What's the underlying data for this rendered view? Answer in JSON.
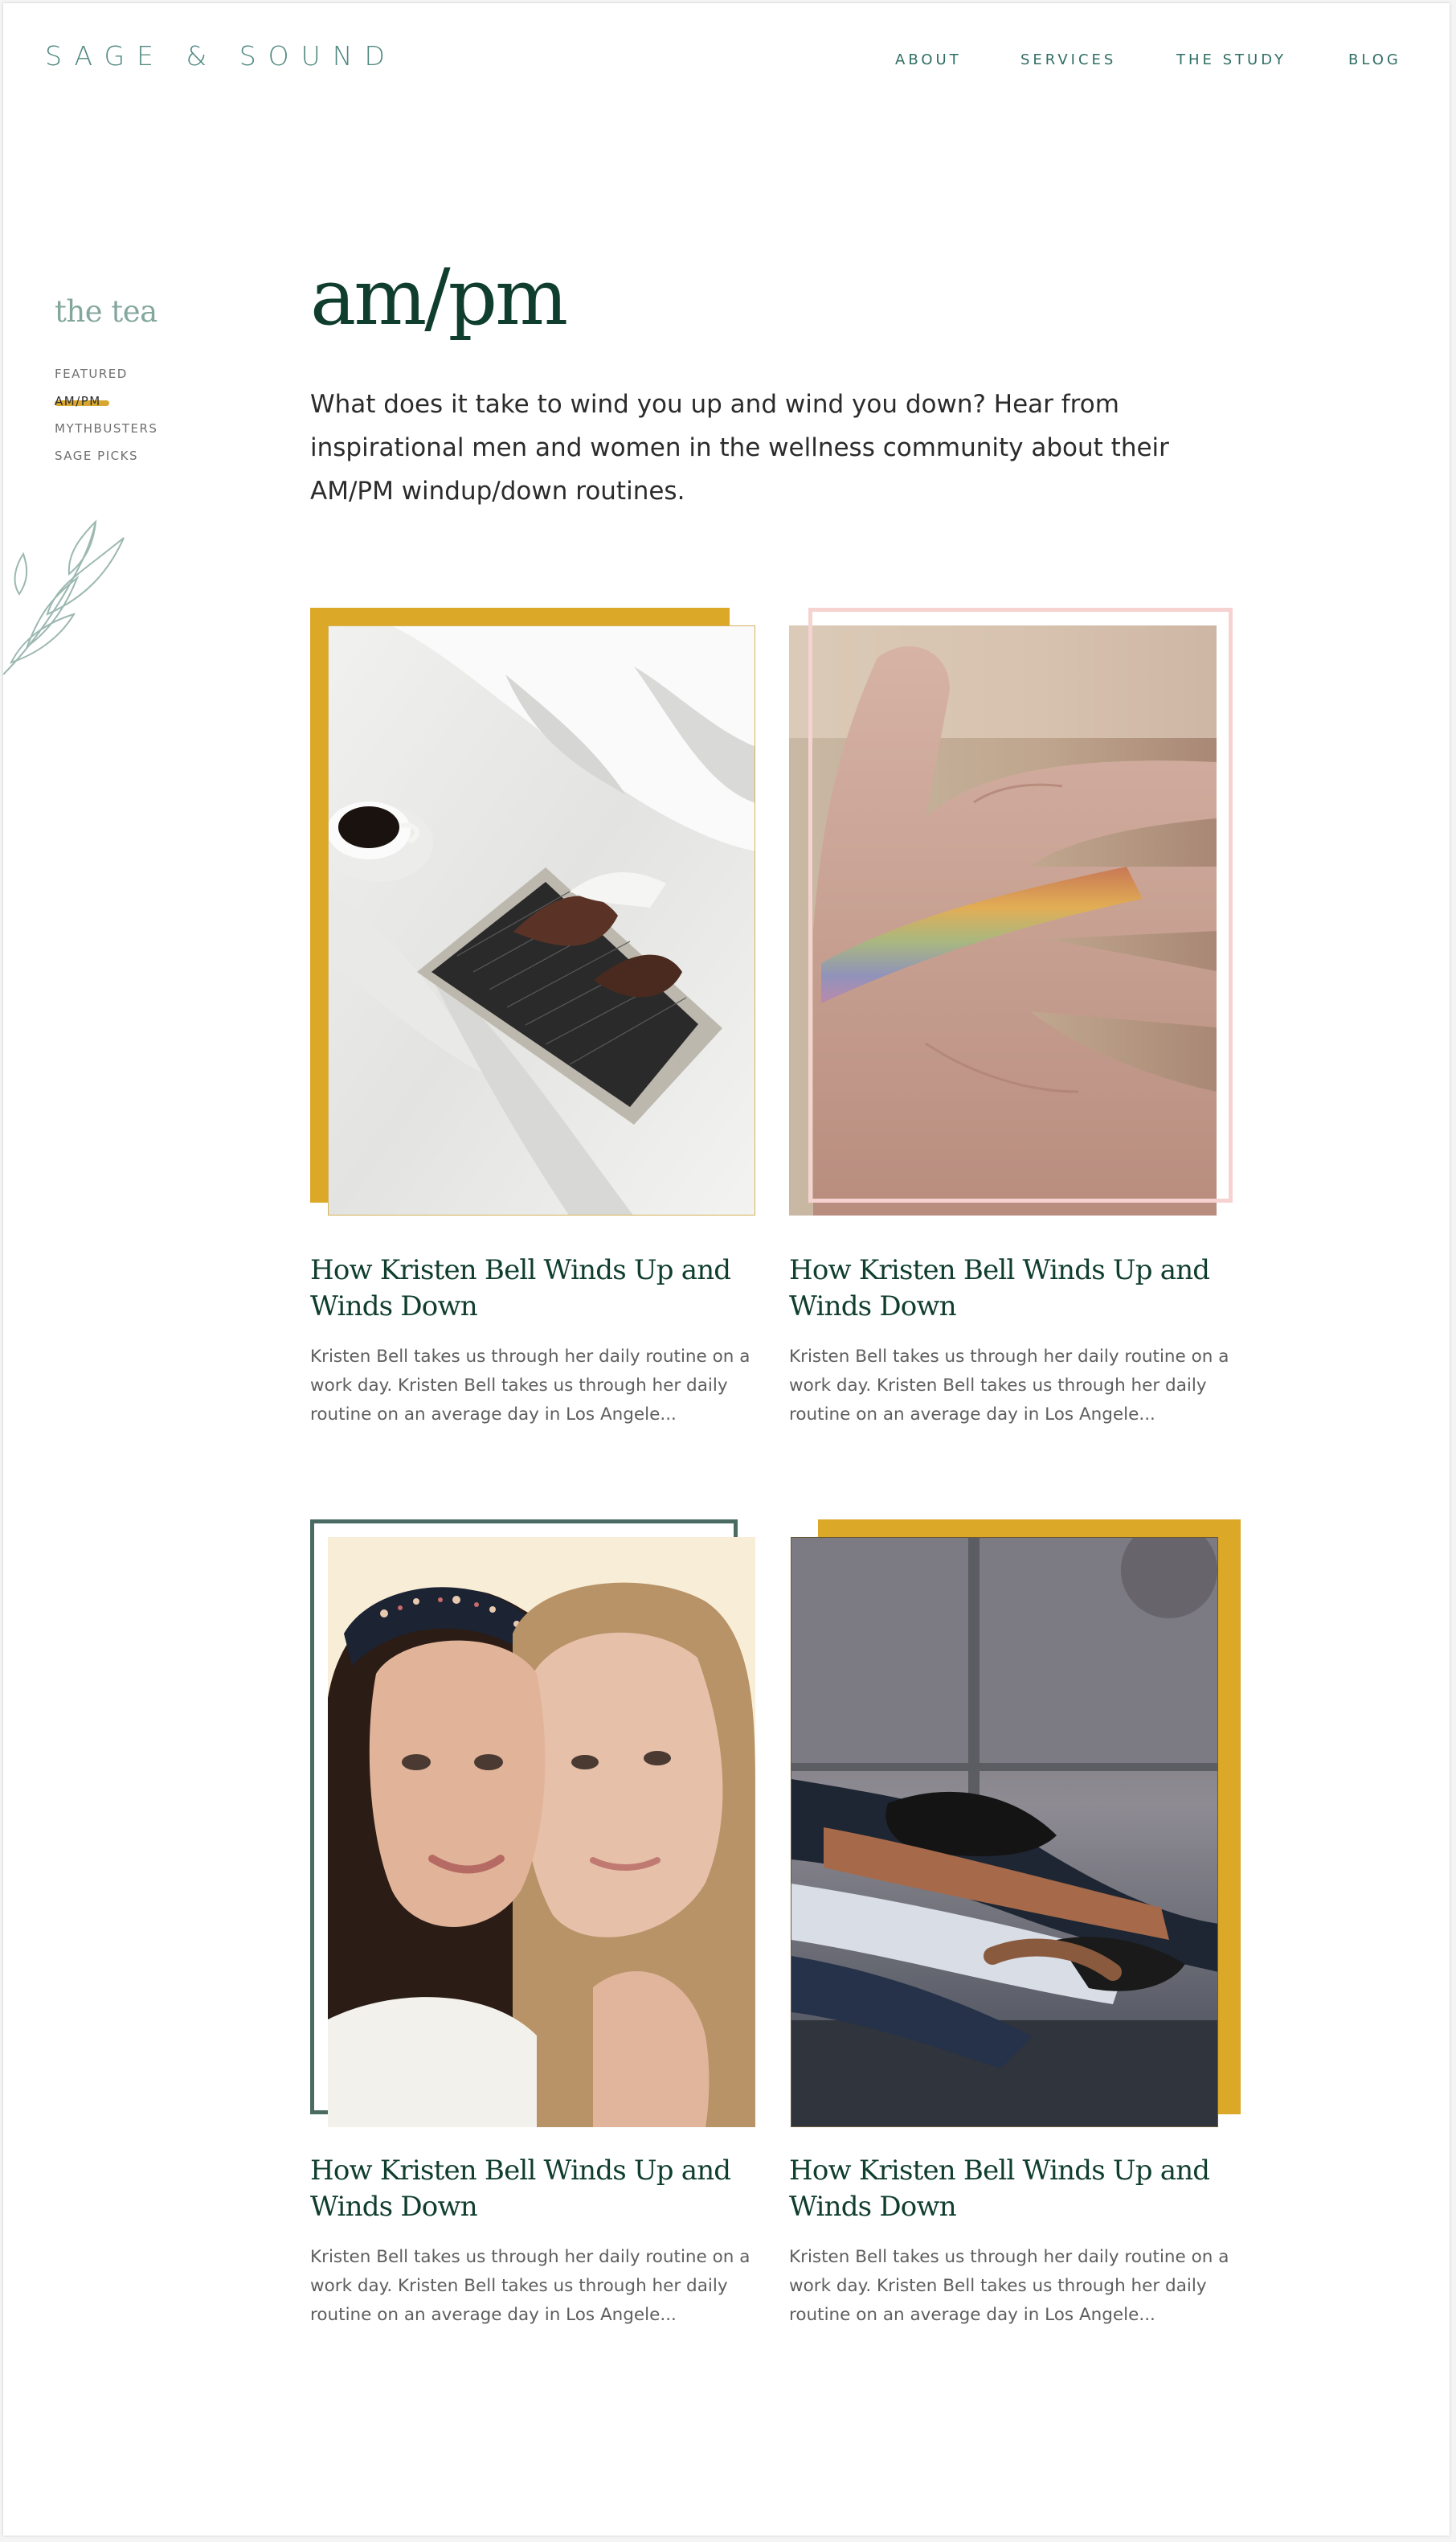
{
  "brand": {
    "name": "SAGE & SOUND"
  },
  "nav": {
    "about": "ABOUT",
    "services": "SERVICES",
    "the_study": "THE STUDY",
    "blog": "BLOG"
  },
  "sidebar": {
    "title": "the tea",
    "items": [
      "FEATURED",
      "AM/PM",
      "MYTHBUSTERS",
      "SAGE PICKS"
    ],
    "active": "AM/PM"
  },
  "page": {
    "title": "am/pm",
    "intro": "What does it take to wind you up and wind you down? Hear from inspirational men and women in the wellness  community about their AM/PM windup/down routines."
  },
  "posts": [
    {
      "title": "How Kristen Bell Winds Up and Winds Down",
      "excerpt": "Kristen Bell takes us through her daily routine on a work day. Kristen Bell takes us through her daily routine on an average day in Los Angele...",
      "image": "laptop-in-bed-photo",
      "frame_color": "#dba828"
    },
    {
      "title": "How Kristen Bell Winds Up and Winds Down",
      "excerpt": "Kristen Bell takes us through her daily routine on a work day. Kristen Bell takes us through her daily routine on an average day in Los Angele...",
      "image": "rainbow-hand-photo",
      "frame_color": "#f6d3d1"
    },
    {
      "title": "How Kristen Bell Winds Up and Winds Down",
      "excerpt": "Kristen Bell takes us through her daily routine on a work day. Kristen Bell takes us through her daily routine on an average day in Los Angele...",
      "image": "two-women-photo",
      "frame_color": "#4a6b62"
    },
    {
      "title": "How Kristen Bell Winds Up and Winds Down",
      "excerpt": "Kristen Bell takes us through her daily routine on a work day. Kristen Bell takes us through her daily routine on an average day in Los Angele...",
      "image": "yoga-stretch-photo",
      "frame_color": "#dba828"
    }
  ],
  "colors": {
    "accent_gold": "#dba828",
    "brand_green": "#0f3d2e",
    "nav_teal": "#2f6e63",
    "blush": "#f6d3d1"
  }
}
